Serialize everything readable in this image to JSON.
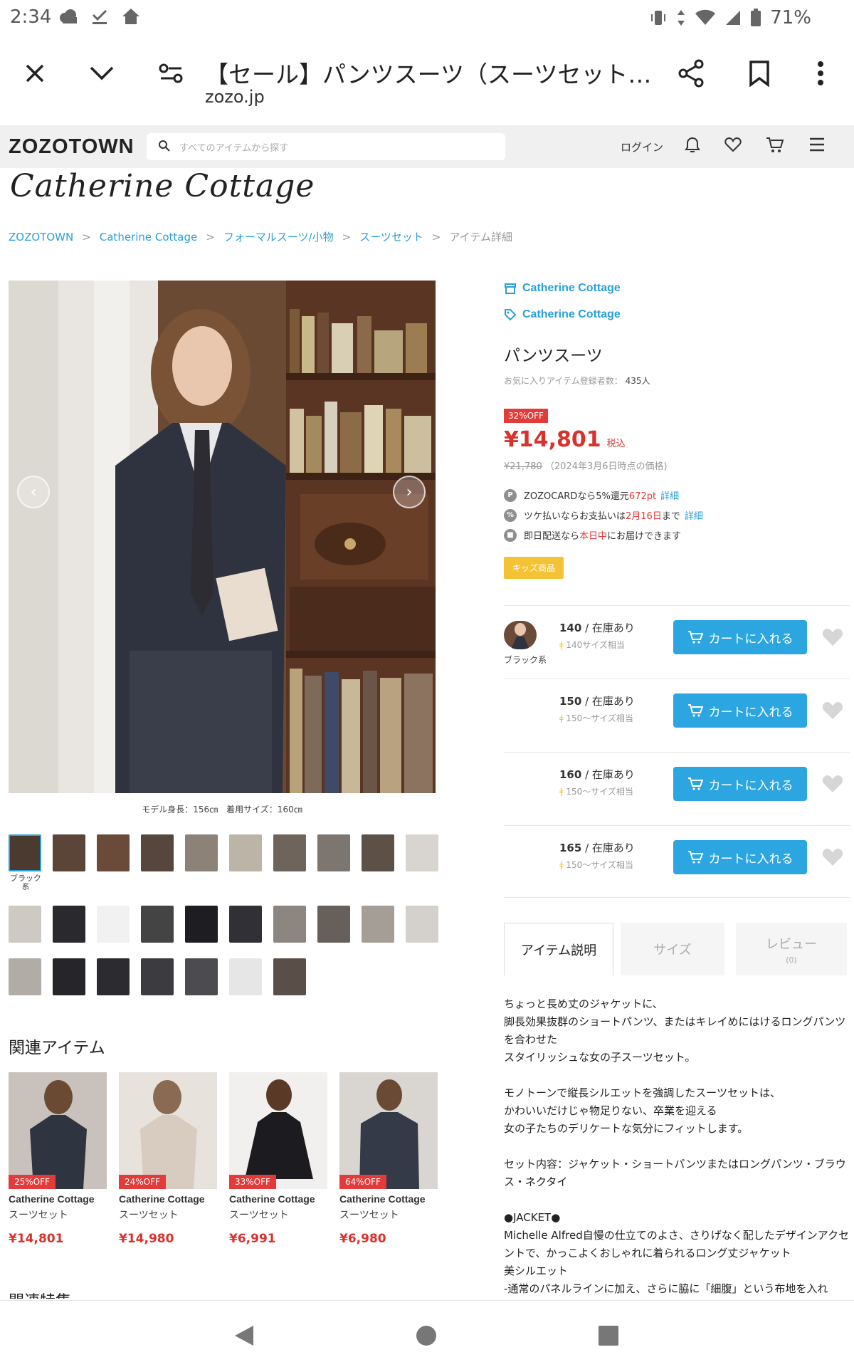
{
  "status_bar": {
    "time": "2:34",
    "battery": "71%"
  },
  "chrome": {
    "title": "【セール】パンツスーツ（スーツセット）...",
    "domain": "zozo.jp",
    "icons": [
      "close-icon",
      "chevron-down-icon",
      "tune-icon",
      "share-icon",
      "bookmark-icon",
      "more-vert-icon"
    ]
  },
  "zozo_header": {
    "logo": "ZOZOTOWN",
    "search_placeholder": "すべてのアイテムから探す",
    "login_label": "ログイン"
  },
  "brand_logo_text": "Catherine Cottage",
  "breadcrumb": {
    "items": [
      "ZOZOTOWN",
      "Catherine Cottage",
      "フォーマルスーツ/小物",
      "スーツセット"
    ],
    "current": "アイテム詳細"
  },
  "gallery": {
    "caption": "モデル身長：156㎝　着用サイズ：160㎝",
    "selected_color_label": "ブラック系"
  },
  "product": {
    "shop_link": "Catherine Cottage",
    "brand_link": "Catherine Cottage",
    "name": "パンツスーツ",
    "fav_label": "お気に入りアイテム登録者数：",
    "fav_count": "435人",
    "off_badge": "32%OFF",
    "price": "¥14,801",
    "tax_label": "税込",
    "orig_price": "¥21,780",
    "orig_note": "（2024年3月6日時点の価格)",
    "zozocard_a": "ZOZOCARDなら5%還元",
    "zozocard_pt": "672pt",
    "zozocard_link": "詳細",
    "tsuke_a": "ツケ払いならお支払いは",
    "tsuke_date": "2月16日",
    "tsuke_b": "まで",
    "tsuke_link": "詳細",
    "delivery_a": "即日配送なら",
    "delivery_red": "本日中",
    "delivery_b": "にお届けできます",
    "kids_badge": "キッズ商品",
    "color_label": "ブラック系",
    "cart_label": "カートに入れる",
    "sizes": [
      {
        "size": "140",
        "stock": " / 在庫あり",
        "note": "140サイズ相当"
      },
      {
        "size": "150",
        "stock": " / 在庫あり",
        "note": "150〜サイズ相当"
      },
      {
        "size": "160",
        "stock": " / 在庫あり",
        "note": "150〜サイズ相当"
      },
      {
        "size": "165",
        "stock": " / 在庫あり",
        "note": "150〜サイズ相当"
      }
    ]
  },
  "tabs": {
    "description": "アイテム説明",
    "size": "サイズ",
    "review": "レビュー",
    "review_count": "(0)"
  },
  "description": [
    "ちょっと長め丈のジャケットに、",
    "脚長効果抜群のショートパンツ、またはキレイめにはけるロングパンツを合わせた",
    "スタイリッシュな女の子スーツセット。",
    "モノトーンで縦長シルエットを強調したスーツセットは、",
    "かわいいだけじゃ物足りない、卒業を迎える",
    "女の子たちのデリケートな気分にフィットします。",
    "セット内容：ジャケット・ショートパンツまたはロングパンツ・ブラウス・ネクタイ",
    "●JACKET●",
    "Michelle Alfred自慢の仕立てのよさ、さりげなく配したデザインアクセントで、かっこよくおしゃれに着られるロング丈ジャケット",
    "美シルエット",
    "-通常のパネルラインに加え、さらに脇に「細腹」という布地を入れ"
  ],
  "related": {
    "title": "関連アイテム",
    "items": [
      {
        "badge": "25%OFF",
        "brand": "Catherine Cottage",
        "category": "スーツセット",
        "price": "¥14,801"
      },
      {
        "badge": "24%OFF",
        "brand": "Catherine Cottage",
        "category": "スーツセット",
        "price": "¥14,980"
      },
      {
        "badge": "33%OFF",
        "brand": "Catherine Cottage",
        "category": "スーツセット",
        "price": "¥6,991"
      },
      {
        "badge": "64%OFF",
        "brand": "Catherine Cottage",
        "category": "スーツセット",
        "price": "¥6,980"
      }
    ],
    "feature_title": "関連特集"
  },
  "colors": {
    "accent_blue": "#2a9fd8",
    "button_blue": "#2ca6e0",
    "sale_red": "#e33a3a",
    "kids_yellow": "#f4c335"
  }
}
